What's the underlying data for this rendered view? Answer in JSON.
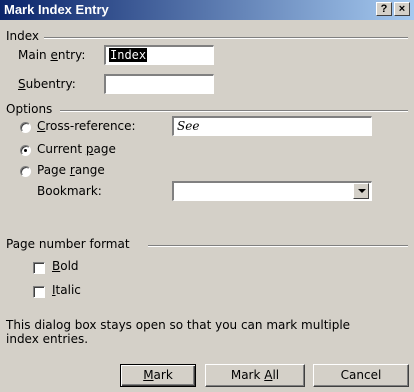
{
  "window": {
    "title": "Mark Index Entry",
    "help_label": "?",
    "close_label": "×"
  },
  "index": {
    "group_label": "Index",
    "main_entry_pre": "Main ",
    "main_entry_acc": "e",
    "main_entry_post": "ntry:",
    "main_entry_value": "Index",
    "subentry_acc": "S",
    "subentry_post": "ubentry:",
    "subentry_value": ""
  },
  "options": {
    "group_label": "Options",
    "cross_reference_acc": "C",
    "cross_reference_post": "ross-reference:",
    "cross_reference_value": "See",
    "current_page_pre": "Current ",
    "current_page_acc": "p",
    "current_page_post": "age",
    "page_range_pre": "Page ",
    "page_range_acc": "r",
    "page_range_post": "ange",
    "bookmark_label": "Bookmark:",
    "bookmark_value": "",
    "selected": "current_page"
  },
  "page_number_format": {
    "group_label": "Page number format",
    "bold_acc": "B",
    "bold_post": "old",
    "bold_checked": false,
    "italic_acc": "I",
    "italic_post": "talic",
    "italic_checked": false
  },
  "info_text": "This dialog box stays open so that you can mark multiple index entries.",
  "buttons": {
    "mark_acc": "M",
    "mark_post": "ark",
    "mark_all_pre": "Mark ",
    "mark_all_acc": "A",
    "mark_all_post": "ll",
    "cancel": "Cancel"
  }
}
